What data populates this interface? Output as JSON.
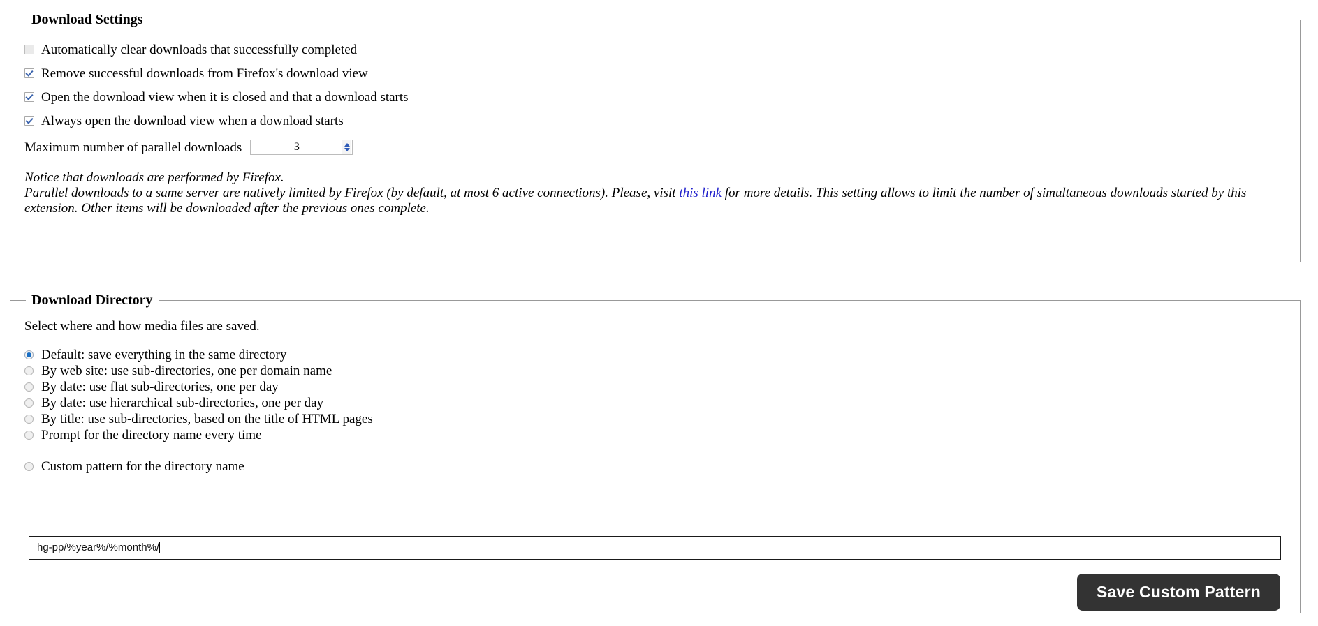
{
  "settings_panel": {
    "legend": "Download Settings",
    "checkboxes": [
      {
        "label": "Automatically clear downloads that successfully completed",
        "checked": false
      },
      {
        "label": "Remove successful downloads from Firefox's download view",
        "checked": true
      },
      {
        "label": "Open the download view when it is closed and that a download starts",
        "checked": true
      },
      {
        "label": "Always open the download view when a download starts",
        "checked": true
      }
    ],
    "max_parallel": {
      "label": "Maximum number of parallel downloads",
      "value": "3"
    },
    "notice": {
      "line1": "Notice that downloads are performed by Firefox.",
      "line2_before_link": "Parallel downloads to a same server are natively limited by Firefox (by default, at most 6 active connections). Please, visit ",
      "link_text": "this link",
      "line2_after_link": " for more details. This setting allows to limit the number of simultaneous downloads started by this extension. Other items will be downloaded after the previous ones complete."
    }
  },
  "directory_panel": {
    "legend": "Download Directory",
    "intro": "Select where and how media files are saved.",
    "radios": [
      {
        "label": "Default: save everything in the same directory",
        "selected": true
      },
      {
        "label": "By web site: use sub-directories, one per domain name",
        "selected": false
      },
      {
        "label": "By date: use flat sub-directories, one per day",
        "selected": false
      },
      {
        "label": "By date: use hierarchical sub-directories, one per day",
        "selected": false
      },
      {
        "label": "By title: use sub-directories, based on the title of HTML pages",
        "selected": false
      },
      {
        "label": "Prompt for the directory name every time",
        "selected": false
      }
    ],
    "custom_radio": {
      "label": "Custom pattern for the directory name",
      "selected": false
    },
    "pattern_input": {
      "value": "hg-pp/%year%/%month%/",
      "placeholder": ""
    },
    "save_button": "Save Custom Pattern"
  },
  "colors": {
    "accent_blue": "#1a6fc4",
    "link_blue": "#2020cc",
    "button_dark": "#333333",
    "border_gray": "#999999"
  }
}
